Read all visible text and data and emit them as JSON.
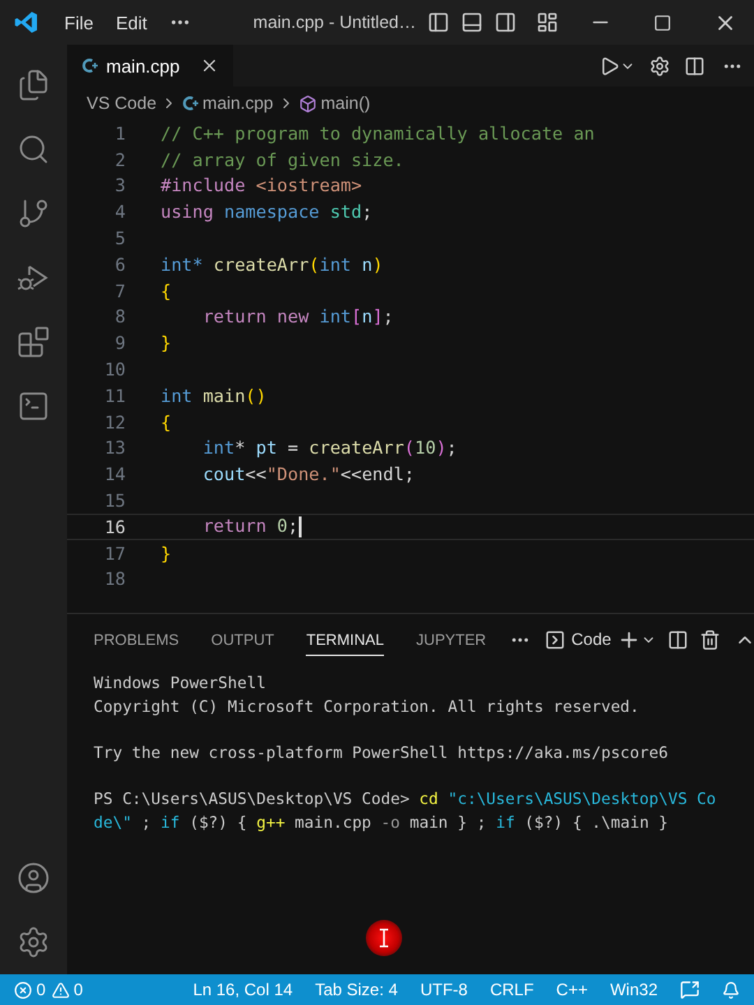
{
  "title_bar": {
    "menus": [
      "File",
      "Edit"
    ],
    "title": "main.cpp - Untitled…"
  },
  "tabs": [
    {
      "label": "main.cpp",
      "selected": true
    }
  ],
  "breadcrumbs": [
    {
      "kind": "folder",
      "label": "VS Code"
    },
    {
      "kind": "file",
      "label": "main.cpp"
    },
    {
      "kind": "symbol",
      "label": "main()"
    }
  ],
  "editor": {
    "lines": [
      {
        "number": "1",
        "current": false,
        "tokens": [
          {
            "kind": "comment",
            "text": "// C++ program to dynamically allocate an"
          }
        ]
      },
      {
        "number": "2",
        "current": false,
        "tokens": [
          {
            "kind": "comment",
            "text": "// array of given size."
          }
        ]
      },
      {
        "number": "3",
        "current": false,
        "tokens": [
          {
            "kind": "control",
            "text": "#include"
          },
          {
            "kind": "string",
            "text": " <iostream>"
          }
        ]
      },
      {
        "number": "4",
        "current": false,
        "tokens": [
          {
            "kind": "control",
            "text": "using"
          },
          {
            "kind": "type",
            "text": " namespace"
          },
          {
            "kind": "class",
            "text": " std"
          },
          {
            "kind": "plain",
            "text": ";"
          }
        ]
      },
      {
        "number": "5",
        "current": false
      },
      {
        "number": "6",
        "current": false,
        "tokens": [
          {
            "kind": "type",
            "text": "int*"
          },
          {
            "kind": "func",
            "text": " createArr"
          },
          {
            "kind": "bracket1",
            "text": "("
          },
          {
            "kind": "type",
            "text": "int"
          },
          {
            "kind": "var",
            "text": " n"
          },
          {
            "kind": "bracket1",
            "text": ")"
          }
        ]
      },
      {
        "number": "7",
        "current": false,
        "tokens": [
          {
            "kind": "bracket1",
            "text": "{"
          }
        ]
      },
      {
        "number": "8",
        "current": false,
        "tokens": [
          {
            "kind": "control",
            "text": "    return"
          },
          {
            "kind": "control",
            "text": " new"
          },
          {
            "kind": "type",
            "text": " int"
          },
          {
            "kind": "bracket2",
            "text": "["
          },
          {
            "kind": "var",
            "text": "n"
          },
          {
            "kind": "bracket2",
            "text": "]"
          },
          {
            "kind": "plain",
            "text": ";"
          }
        ]
      },
      {
        "number": "9",
        "current": false,
        "tokens": [
          {
            "kind": "bracket1",
            "text": "}"
          }
        ]
      },
      {
        "number": "10",
        "current": false
      },
      {
        "number": "11",
        "current": false,
        "tokens": [
          {
            "kind": "type",
            "text": "int"
          },
          {
            "kind": "func",
            "text": " main"
          },
          {
            "kind": "bracket1",
            "text": "()"
          }
        ]
      },
      {
        "number": "12",
        "current": false,
        "tokens": [
          {
            "kind": "bracket1",
            "text": "{"
          }
        ]
      },
      {
        "number": "13",
        "current": false,
        "tokens": [
          {
            "kind": "type",
            "text": "    int"
          },
          {
            "kind": "plain",
            "text": "*"
          },
          {
            "kind": "var",
            "text": " pt"
          },
          {
            "kind": "plain",
            "text": " ="
          },
          {
            "kind": "func",
            "text": " createArr"
          },
          {
            "kind": "bracket2",
            "text": "("
          },
          {
            "kind": "number",
            "text": "10"
          },
          {
            "kind": "bracket2",
            "text": ")"
          },
          {
            "kind": "plain",
            "text": ";"
          }
        ]
      },
      {
        "number": "14",
        "current": false,
        "tokens": [
          {
            "kind": "var",
            "text": "    cout"
          },
          {
            "kind": "plain",
            "text": "<<"
          },
          {
            "kind": "string",
            "text": "\"Done.\""
          },
          {
            "kind": "plain",
            "text": "<<endl;"
          }
        ]
      },
      {
        "number": "15",
        "current": false
      },
      {
        "number": "16",
        "current": true,
        "tokens": [
          {
            "kind": "control",
            "text": "    return"
          },
          {
            "kind": "number",
            "text": " 0"
          },
          {
            "kind": "plain",
            "text": ";"
          }
        ]
      },
      {
        "number": "17",
        "current": false,
        "tokens": [
          {
            "kind": "bracket1",
            "text": "}"
          }
        ]
      },
      {
        "number": "18",
        "current": false
      }
    ]
  },
  "panel": {
    "tabs": [
      {
        "label": "PROBLEMS",
        "selected": false
      },
      {
        "label": "OUTPUT",
        "selected": false
      },
      {
        "label": "TERMINAL",
        "selected": true
      },
      {
        "label": "JUPYTER",
        "selected": false
      }
    ],
    "terminal_name": "Code",
    "terminal_lines": [
      {
        "kind": "output",
        "tokens": [
          {
            "kind": "plain",
            "text": "Windows PowerShell"
          }
        ]
      },
      {
        "kind": "output",
        "tokens": [
          {
            "kind": "plain",
            "text": "Copyright (C) Microsoft Corporation. All rights reserved."
          }
        ]
      },
      {
        "kind": "blank"
      },
      {
        "kind": "output",
        "tokens": [
          {
            "kind": "plain",
            "text": "Try the new cross-platform PowerShell https://aka.ms/pscore6"
          }
        ]
      },
      {
        "kind": "blank"
      },
      {
        "kind": "output",
        "tokens": [
          {
            "kind": "plain",
            "text": "PS C:\\Users\\ASUS\\Desktop\\VS Code>"
          },
          {
            "kind": "command",
            "text": " cd"
          },
          {
            "kind": "string",
            "text": " \"c:\\Users\\ASUS\\Desktop\\VS Co"
          }
        ]
      },
      {
        "kind": "output",
        "tokens": [
          {
            "kind": "string",
            "text": "de\\\""
          },
          {
            "kind": "plain",
            "text": " ;"
          },
          {
            "kind": "keyword",
            "text": " if"
          },
          {
            "kind": "plain",
            "text": " ($?) {"
          },
          {
            "kind": "command",
            "text": " g++"
          },
          {
            "kind": "plain",
            "text": " main.cpp"
          },
          {
            "kind": "dim",
            "text": " -o"
          },
          {
            "kind": "plain",
            "text": " main } ;"
          },
          {
            "kind": "keyword",
            "text": " if"
          },
          {
            "kind": "plain",
            "text": " ($?) { .\\main }"
          }
        ]
      }
    ]
  },
  "status_bar": {
    "errors": "0",
    "warnings": "0",
    "items": [
      "Ln 16, Col 14",
      "Tab Size: 4",
      "UTF-8",
      "CRLF",
      "C++",
      "Win32"
    ]
  }
}
